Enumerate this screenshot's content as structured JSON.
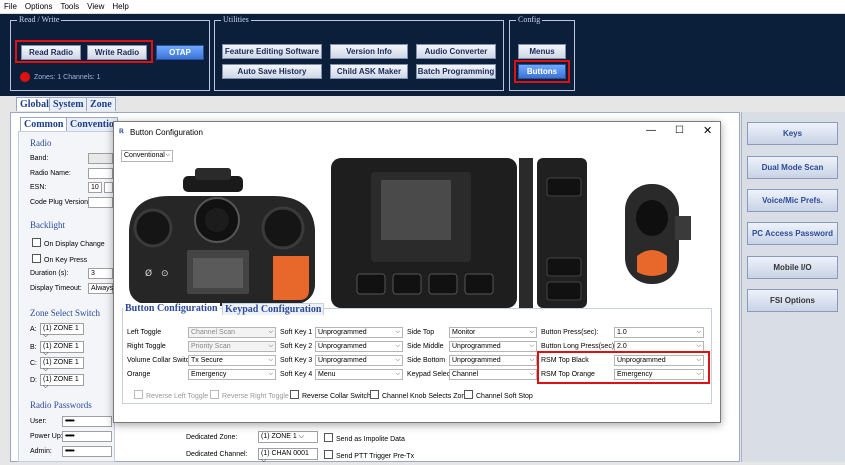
{
  "menu": [
    "File",
    "Options",
    "Tools",
    "View",
    "Help"
  ],
  "groups": {
    "read_write": {
      "title": "Read / Write",
      "read_radio": "Read Radio",
      "write_radio": "Write Radio",
      "otap": "OTAP",
      "zones_info": "Zones: 1 Channels: 1"
    },
    "utilities": {
      "title": "Utilities",
      "feature_editing": "Feature Editing Software",
      "version_info": "Version Info",
      "audio_converter": "Audio Converter",
      "auto_save": "Auto Save History",
      "child_ask": "Child ASK Maker",
      "batch": "Batch Programming"
    },
    "config": {
      "title": "Config",
      "menus": "Menus",
      "buttons": "Buttons"
    }
  },
  "tabs": {
    "global": "Global",
    "system": "System",
    "zone": "Zone"
  },
  "subtabs": {
    "common": "Common",
    "conventional": "Conventio"
  },
  "radio_section": {
    "title": "Radio",
    "band": "Band:",
    "radio_name": "Radio Name:",
    "esn": "ESN:",
    "esn_value": "10",
    "code_plug": "Code Plug Version:"
  },
  "backlight": {
    "title": "Backlight",
    "on_display": "On Display Change",
    "on_key": "On Key Press",
    "duration": "Duration (s):",
    "duration_value": "3",
    "timeout": "Display Timeout:",
    "timeout_value": "Always"
  },
  "zone_select": {
    "title": "Zone Select Switch",
    "rows": [
      {
        "label": "A:",
        "value": "(1) ZONE 1"
      },
      {
        "label": "B:",
        "value": "(1) ZONE 1"
      },
      {
        "label": "C:",
        "value": "(1) ZONE 1"
      },
      {
        "label": "D:",
        "value": "(1) ZONE 1"
      }
    ]
  },
  "passwords": {
    "title": "Radio Passwords",
    "user": "User:",
    "power_up": "Power Up:",
    "admin": "Admin:",
    "mask": "••••••"
  },
  "bottom_fields": {
    "dedicated_zone": "Dedicated Zone:",
    "dedicated_zone_value": "(1) ZONE 1",
    "send_impolite": "Send as Impolite Data",
    "dedicated_channel": "Dedicated Channel:",
    "dedicated_channel_value": "(1) CHAN 0001",
    "send_ptt": "Send PTT Trigger Pre-Tx"
  },
  "right_panel": [
    "Keys",
    "Dual Mode Scan",
    "Voice/Mic Prefs.",
    "PC Access Password",
    "Mobile I/O",
    "FSI Options"
  ],
  "dialog": {
    "title": "Button Configuration",
    "mode": "Conventional",
    "tab_button": "Button Configuration",
    "tab_keypad": "Keypad Configuration",
    "col1": [
      {
        "label": "Left Toggle",
        "value": "Channel Scan",
        "disabled": true
      },
      {
        "label": "Right Toggle",
        "value": "Priority Scan",
        "disabled": true
      },
      {
        "label": "Volume Collar Switch",
        "value": "Tx Secure",
        "disabled": false
      },
      {
        "label": "Orange",
        "value": "Emergency",
        "disabled": false
      }
    ],
    "col2": [
      {
        "label": "Soft Key 1",
        "value": "Unprogrammed"
      },
      {
        "label": "Soft Key 2",
        "value": "Unprogrammed"
      },
      {
        "label": "Soft Key 3",
        "value": "Unprogrammed"
      },
      {
        "label": "Soft Key 4",
        "value": "Menu"
      }
    ],
    "col3": [
      {
        "label": "Side Top",
        "value": "Monitor"
      },
      {
        "label": "Side Middle",
        "value": "Unprogrammed"
      },
      {
        "label": "Side Bottom",
        "value": "Unprogrammed"
      },
      {
        "label": "Keypad Select",
        "value": "Channel"
      }
    ],
    "col4": [
      {
        "label": "Button Press(sec):",
        "value": "1.0"
      },
      {
        "label": "Button Long Press(sec):",
        "value": "2.0"
      },
      {
        "label": "RSM Top Black",
        "value": "Unprogrammed"
      },
      {
        "label": "RSM Top Orange",
        "value": "Emergency"
      }
    ],
    "checks": [
      "Reverse Left Toggle",
      "Reverse Right Toggle",
      "Reverse Collar Switch",
      "Channel Knob Selects Zone",
      "Channel Soft Stop"
    ]
  },
  "colors": {
    "highlight": "#e01010",
    "accent_blue": "#3b74d6",
    "dark_bg": "#0b1f3a"
  }
}
